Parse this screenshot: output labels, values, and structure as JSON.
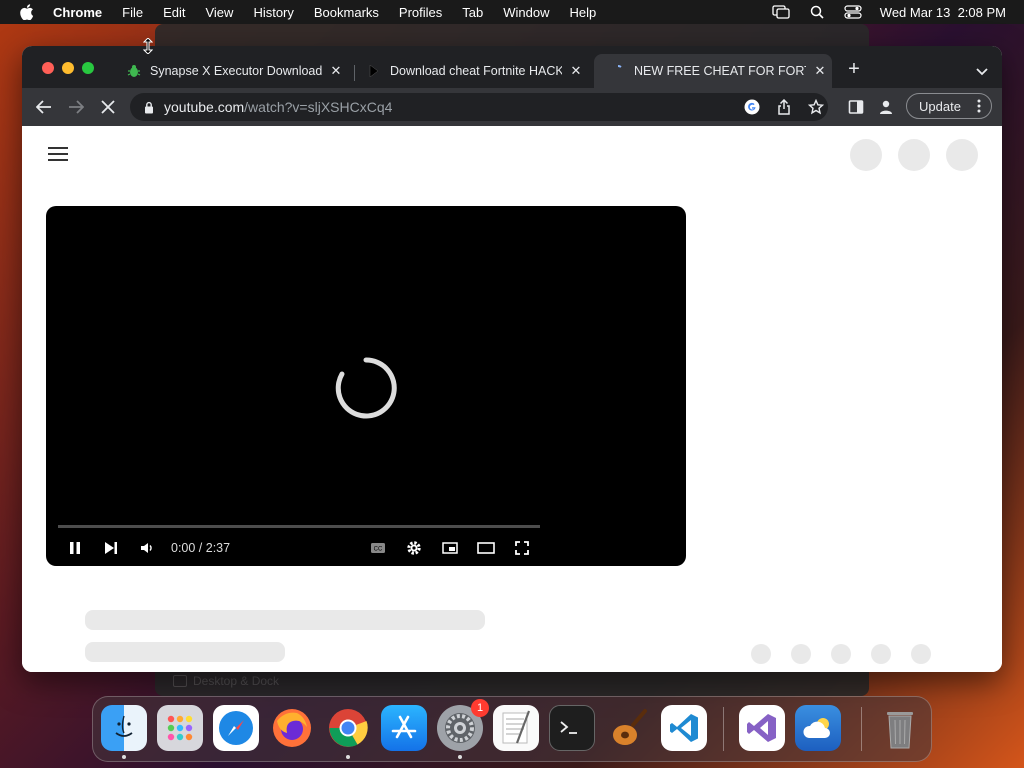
{
  "menubar": {
    "app_name": "Chrome",
    "menus": [
      "File",
      "Edit",
      "View",
      "History",
      "Bookmarks",
      "Profiles",
      "Tab",
      "Window",
      "Help"
    ],
    "clock": "Wed Mar 13  2:08 PM"
  },
  "background_window": {
    "label": "Desktop & Dock"
  },
  "browser": {
    "tabs": [
      {
        "title": "Synapse X Executor Download",
        "icon": "bug-icon",
        "active": false
      },
      {
        "title": "Download cheat Fortnite HACK",
        "icon": "play-icon",
        "active": false
      },
      {
        "title": "NEW FREE CHEAT FOR FORTN",
        "icon": "loading-icon",
        "active": true
      }
    ],
    "url_host": "youtube.com",
    "url_path": "/watch?v=sljXSHCxCq4",
    "update_label": "Update"
  },
  "player": {
    "time": "0:00 / 2:37",
    "progress": 0
  },
  "dock": {
    "apps": [
      "Finder",
      "Launchpad",
      "Safari",
      "Firefox",
      "Chrome",
      "App Store",
      "System Settings",
      "TextEdit",
      "Terminal",
      "GarageBand",
      "Visual Studio Code",
      "Visual Studio",
      "Weather",
      "Trash"
    ],
    "settings_badge": "1"
  },
  "colors": {
    "tabstrip": "#202124",
    "toolbar": "#35363a",
    "accent_red": "#ff5f57"
  }
}
